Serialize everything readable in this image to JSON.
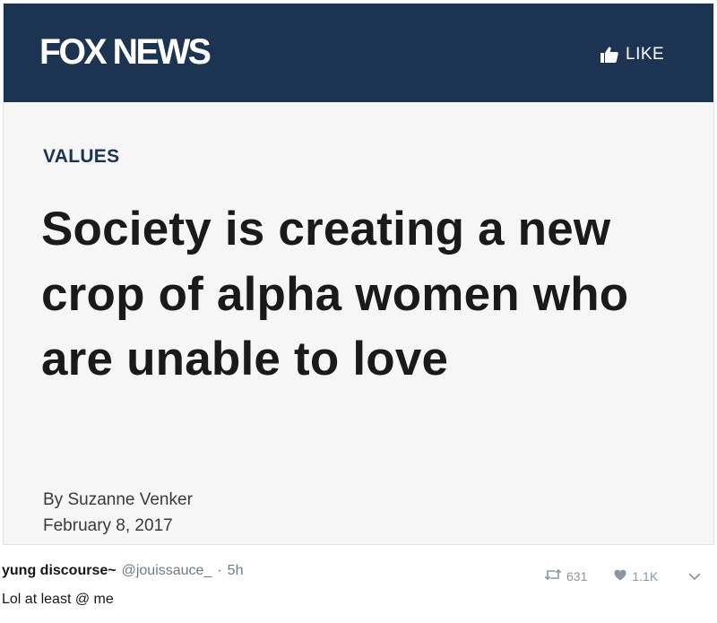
{
  "article": {
    "brand": "FOX NEWS",
    "like_label": "LIKE",
    "section": "VALUES",
    "headline": "Society is creating a new crop of alpha women who are unable to love",
    "byline": "By Suzanne Venker",
    "date": "February 8, 2017"
  },
  "tweet": {
    "display_name": "yung discourse~",
    "handle": "@jouissauce_",
    "separator": "·",
    "time": "5h",
    "text": "Lol at least @ me",
    "retweet_count": "631",
    "like_count": "1.1K"
  },
  "colors": {
    "header_bg": "#1c3452",
    "card_bg": "#f6f6f6",
    "section_text": "#1c3452",
    "action_gray": "#8a97a3"
  },
  "icons": [
    "thumbs-up-icon",
    "retweet-icon",
    "heart-icon",
    "chevron-down-icon"
  ]
}
